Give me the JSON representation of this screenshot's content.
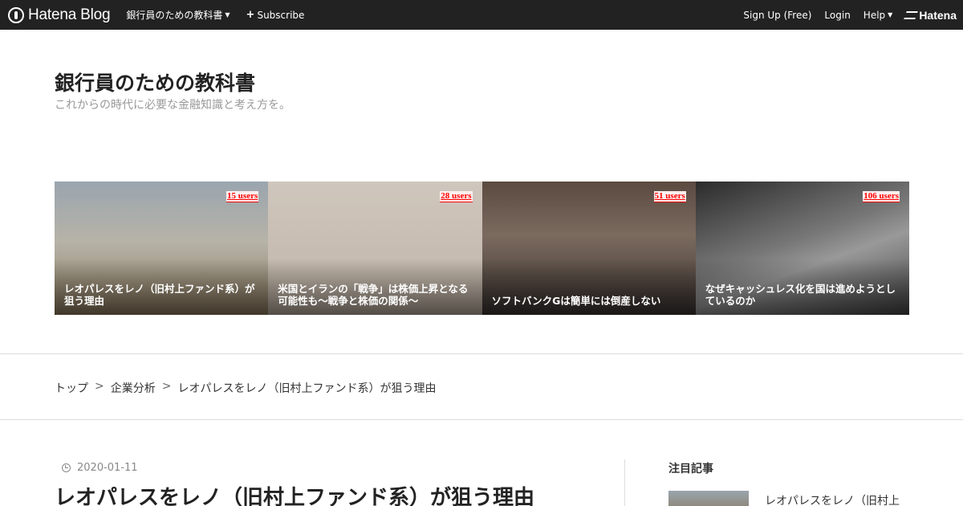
{
  "topbar": {
    "logo_text": "Hatena Blog",
    "blog_menu": "銀行員のための教科書",
    "subscribe": "Subscribe",
    "signup": "Sign Up (Free)",
    "login": "Login",
    "help": "Help",
    "hatena": "Hatena"
  },
  "header": {
    "title": "銀行員のための教科書",
    "description": "これからの時代に必要な金融知識と考え方を。"
  },
  "featured": [
    {
      "title": "レオパレスをレノ（旧村上ファンド系）が狙う理由",
      "users": "15 users"
    },
    {
      "title": "米国とイランの「戦争」は株価上昇となる可能性も〜戦争と株価の関係〜",
      "users": "28 users"
    },
    {
      "title": "ソフトバンクGは簡単には倒産しない",
      "users": "51 users"
    },
    {
      "title": "なぜキャッシュレス化を国は進めようとしているのか",
      "users": "106 users"
    }
  ],
  "breadcrumb": {
    "top": "トップ",
    "category": "企業分析",
    "current": "レオパレスをレノ（旧村上ファンド系）が狙う理由",
    "separator": ">"
  },
  "entry": {
    "date": "2020-01-11",
    "title": "レオパレスをレノ（旧村上ファンド系）が狙う理由"
  },
  "sidebar": {
    "heading": "注目記事",
    "first_item": "レオパレスをレノ（旧村上"
  }
}
